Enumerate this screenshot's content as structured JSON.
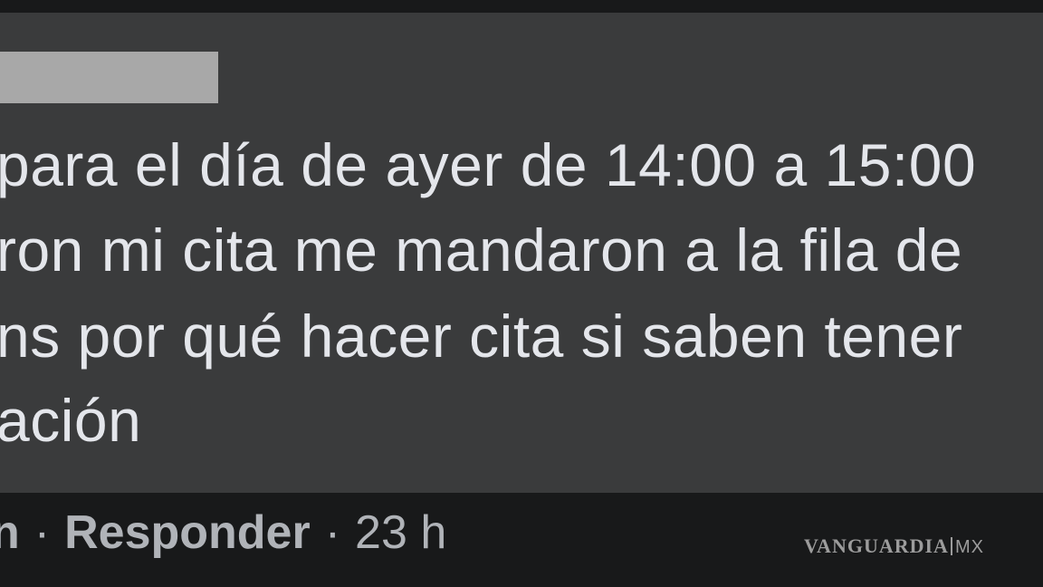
{
  "comment": {
    "lines": [
      "para el día de ayer de 14:00 a 15:00",
      "ron mi cita me mandaron a la fila de",
      "ns por qué hacer cita si saben tener",
      "ación"
    ]
  },
  "actions": {
    "cut_link": "n",
    "separator": "·",
    "reply_label": "Responder",
    "timestamp": "23 h"
  },
  "watermark": {
    "brand": "VANGUARDIA",
    "suffix": "MX"
  },
  "colors": {
    "bubble_bg": "#3a3b3c",
    "page_bg": "#18191a",
    "text": "#e4e6eb",
    "secondary_text": "#b0b3b8",
    "redaction": "#a8a8a8"
  }
}
